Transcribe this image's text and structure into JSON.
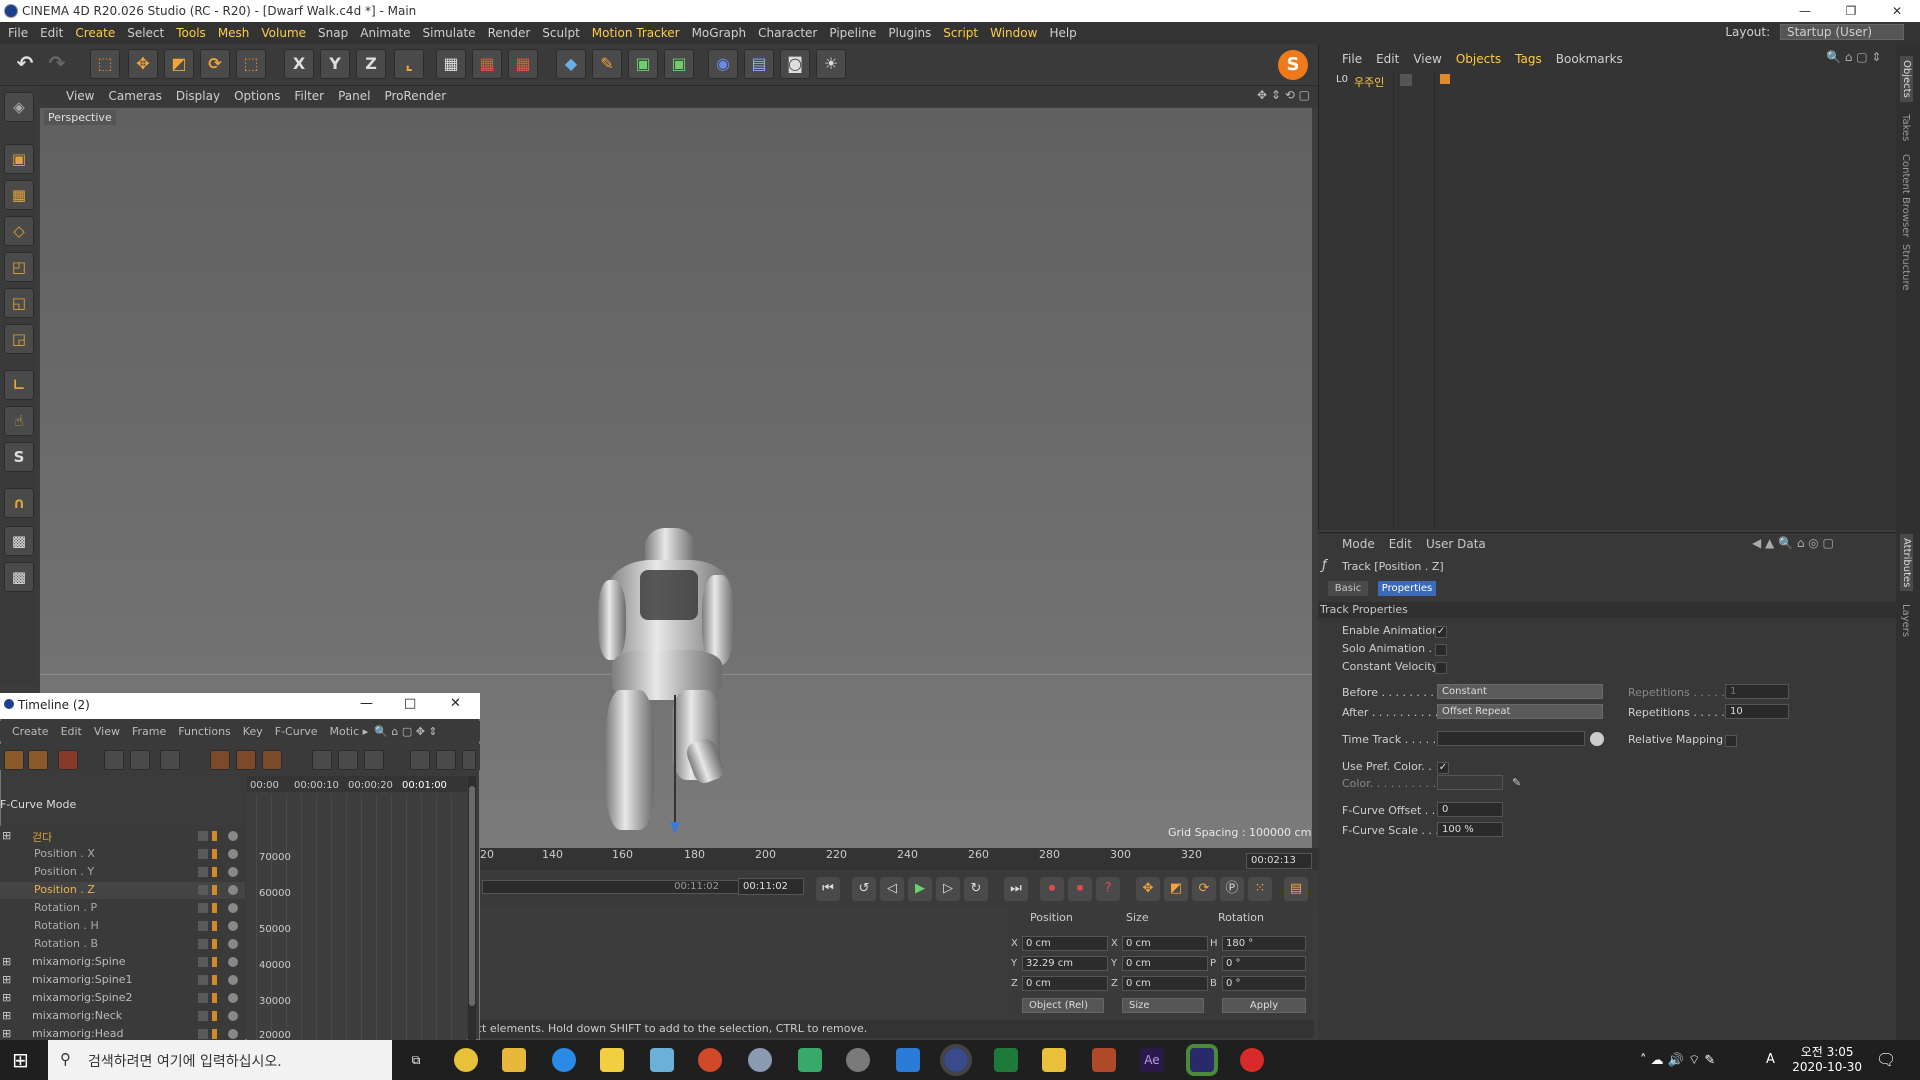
{
  "window": {
    "title": "CINEMA 4D R20.026 Studio (RC - R20) - [Dwarf Walk.c4d *] - Main",
    "min": "—",
    "restore": "❐",
    "close": "✕"
  },
  "menu": [
    "File",
    "Edit",
    "Create",
    "Select",
    "Tools",
    "Mesh",
    "Volume",
    "Snap",
    "Animate",
    "Simulate",
    "Render",
    "Sculpt",
    "Motion Tracker",
    "MoGraph",
    "Character",
    "Pipeline",
    "Plugins",
    "Script",
    "Window",
    "Help"
  ],
  "layout": {
    "label": "Layout:",
    "value": "Startup (User)"
  },
  "toolbar_glyphs": {
    "x": "X",
    "y": "Y",
    "z": "Z"
  },
  "left_tools": {
    "s": "S"
  },
  "viewport": {
    "menu": [
      "View",
      "Cameras",
      "Display",
      "Options",
      "Filter",
      "Panel",
      "ProRender"
    ],
    "label": "Perspective",
    "grid_spacing": "Grid Spacing : 100000 cm"
  },
  "ruler": {
    "ticks": [
      "20",
      "140",
      "160",
      "180",
      "200",
      "220",
      "240",
      "260",
      "280",
      "300",
      "320"
    ],
    "current_time": "00:02:13",
    "time_a": "00:11:02",
    "time_b": "00:11:02"
  },
  "coords": {
    "headers": {
      "position": "Position",
      "size": "Size",
      "rotation": "Rotation"
    },
    "labels": {
      "x": "X",
      "y": "Y",
      "z": "Z",
      "h": "H",
      "p": "P",
      "b": "B"
    },
    "position": {
      "x": "0 cm",
      "y": "32.29 cm",
      "z": "0 cm"
    },
    "size": {
      "x": "0 cm",
      "y": "0 cm",
      "z": "0 cm"
    },
    "rotation": {
      "h": "180 °",
      "p": "0 °",
      "b": "0 °"
    },
    "mode": "Object (Rel)",
    "size_mode": "Size",
    "apply": "Apply"
  },
  "status": "ct elements. Hold down SHIFT to add to the selection, CTRL to remove.",
  "objects": {
    "menu": [
      "File",
      "Edit",
      "View",
      "Objects",
      "Tags",
      "Bookmarks"
    ],
    "item": "우주인",
    "item_prefix": "L0"
  },
  "attributes": {
    "menu": [
      "Mode",
      "Edit",
      "User Data"
    ],
    "title": "Track [Position . Z]",
    "tabs": [
      "Basic",
      "Properties"
    ],
    "section": "Track Properties",
    "enable_animation": "Enable Animation",
    "solo_animation": "Solo Animation . .",
    "constant_velocity": "Constant Velocity",
    "before_label": "Before . . . . . . . . .",
    "before_value": "Constant",
    "after_label": "After . . . . . . . . . .",
    "after_value": "Offset Repeat",
    "repetitions_label": "Repetitions . . . . .",
    "repetitions_before": "1",
    "repetitions_after": "10",
    "time_track": "Time Track . . . . .",
    "relative_mapping": "Relative Mapping",
    "use_pref_color": "Use Pref. Color. .",
    "color": "Color. . . . . . . . . .",
    "fcurve_offset_label": "F-Curve Offset . .",
    "fcurve_offset": "0",
    "fcurve_scale_label": "F-Curve Scale . . .",
    "fcurve_scale": "100 %",
    "check": "✓"
  },
  "side_tabs": [
    "Objects",
    "Takes",
    "Content Browser",
    "Structure",
    "Attributes",
    "Layers"
  ],
  "timeline": {
    "title": "Timeline (2)",
    "menu": [
      "Create",
      "Edit",
      "View",
      "Frame",
      "Functions",
      "Key",
      "F-Curve",
      "Motic ▸"
    ],
    "mode": "F-Curve Mode",
    "time_ticks": [
      "00:00",
      "00:00:10",
      "00:00:20",
      "00:01:00"
    ],
    "y_labels": [
      "70000",
      "60000",
      "50000",
      "40000",
      "30000",
      "20000"
    ],
    "tracks": [
      {
        "name": "걷다",
        "color": "#d8a03a"
      },
      {
        "name": "Position . X",
        "color": "#aaaaaa"
      },
      {
        "name": "Position . Y",
        "color": "#aaaaaa"
      },
      {
        "name": "Position . Z",
        "color": "#e8b04a"
      },
      {
        "name": "Rotation . P",
        "color": "#aaaaaa"
      },
      {
        "name": "Rotation . H",
        "color": "#aaaaaa"
      },
      {
        "name": "Rotation . B",
        "color": "#aaaaaa"
      },
      {
        "name": "mixamorig:Spine",
        "color": "#bbbbbb"
      },
      {
        "name": "mixamorig:Spine1",
        "color": "#bbbbbb"
      },
      {
        "name": "mixamorig:Spine2",
        "color": "#bbbbbb"
      },
      {
        "name": "mixamorig:Neck",
        "color": "#bbbbbb"
      },
      {
        "name": "mixamorig:Head",
        "color": "#bbbbbb"
      }
    ]
  },
  "taskbar": {
    "search": "검색하려면 여기에 입력하십시오.",
    "ampm": "오전 3:05",
    "date": "2020-10-30",
    "ime": "A",
    "ae": "Ae"
  }
}
